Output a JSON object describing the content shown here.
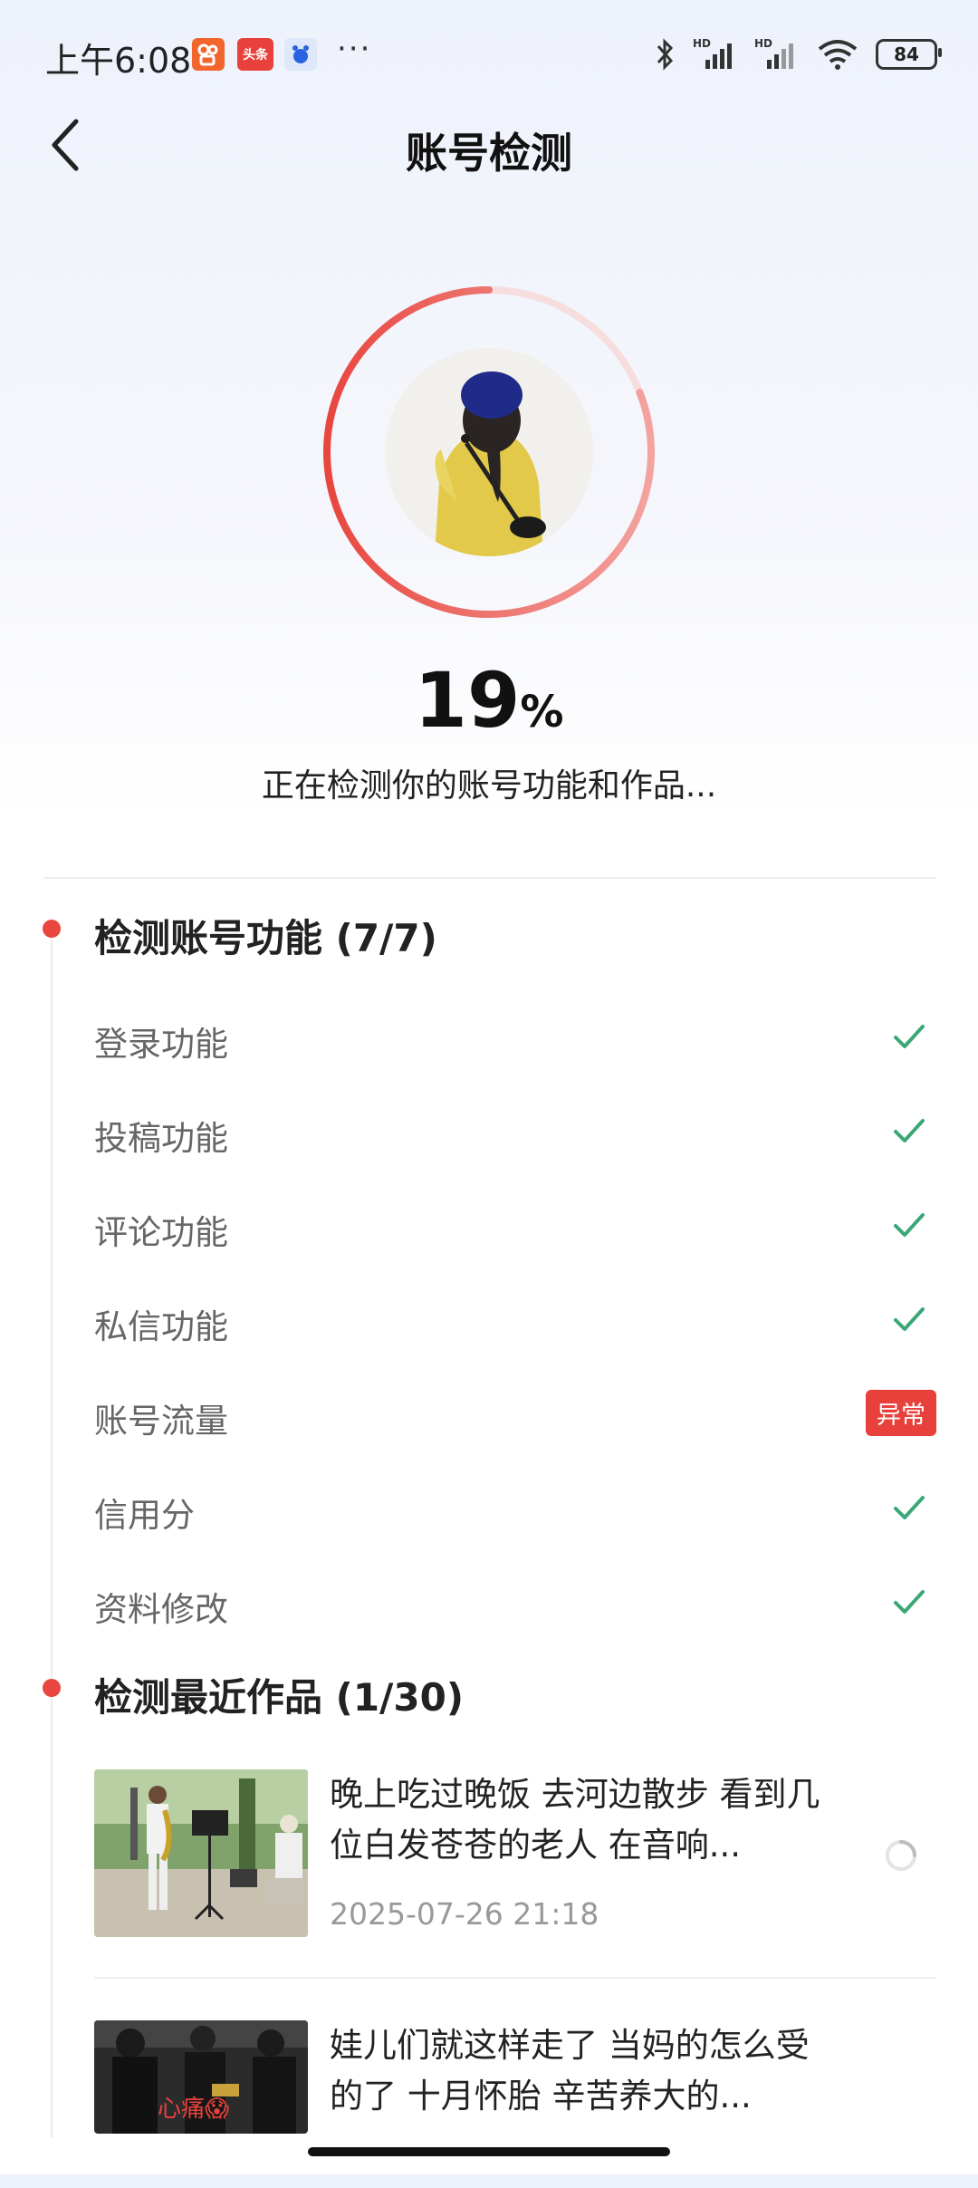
{
  "status_bar": {
    "time": "上午6:08",
    "app_badge_toutiao": "头条",
    "more": "···",
    "battery": "84",
    "hd1": "HD",
    "hd2": "HD"
  },
  "header": {
    "title": "账号检测",
    "back_icon": "chevron-left-icon"
  },
  "progress": {
    "percent": "19",
    "unit": "%",
    "value": 0.19,
    "status_text": "正在检测你的账号功能和作品...",
    "ring_color": "#e8463f"
  },
  "functions": {
    "title": "检测账号功能 (7/7)",
    "items": [
      {
        "label": "登录功能",
        "status": "ok"
      },
      {
        "label": "投稿功能",
        "status": "ok"
      },
      {
        "label": "评论功能",
        "status": "ok"
      },
      {
        "label": "私信功能",
        "status": "ok"
      },
      {
        "label": "账号流量",
        "status": "abnormal",
        "badge": "异常"
      },
      {
        "label": "信用分",
        "status": "ok"
      },
      {
        "label": "资料修改",
        "status": "ok"
      }
    ]
  },
  "works": {
    "title": "检测最近作品 (1/30)",
    "items": [
      {
        "title": "晚上吃过晚饭 去河边散步 看到几位白发苍苍的老人 在音响...",
        "date": "2025-07-26 21:18",
        "status": "loading"
      },
      {
        "title": "娃儿们就这样走了 当妈的怎么受的了 十月怀胎 辛苦养大的...",
        "thumb_text": "心痛😱"
      }
    ]
  },
  "colors": {
    "accent": "#e8463f",
    "check": "#3aa776",
    "badge": "#e8413c"
  }
}
